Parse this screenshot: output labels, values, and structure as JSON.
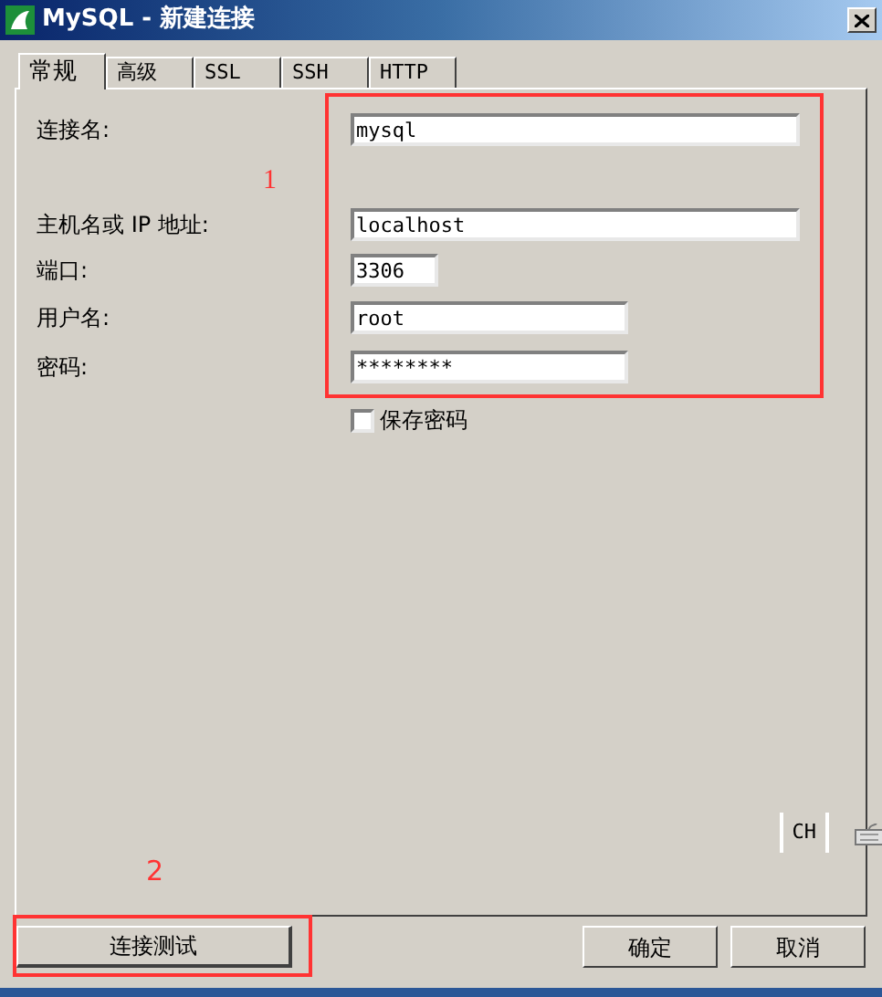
{
  "window": {
    "title": "MySQL - 新建连接"
  },
  "tabs": [
    {
      "label": "常规",
      "selected": true
    },
    {
      "label": "高级",
      "selected": false
    },
    {
      "label": "SSL",
      "selected": false
    },
    {
      "label": "SSH",
      "selected": false
    },
    {
      "label": "HTTP",
      "selected": false
    }
  ],
  "form": {
    "fields": [
      {
        "label": "连接名:",
        "value": "mysql",
        "kind": "wide"
      },
      {
        "label": "主机名或 IP 地址:",
        "value": "localhost",
        "kind": "wide"
      },
      {
        "label": "端口:",
        "value": "3306",
        "kind": "short"
      },
      {
        "label": "用户名:",
        "value": "root",
        "kind": "medium"
      },
      {
        "label": "密码:",
        "value": "********",
        "kind": "medium"
      }
    ],
    "save_password": {
      "label": "保存密码",
      "checked": false
    }
  },
  "ime": {
    "label": "CH"
  },
  "buttons": [
    {
      "label": "连接测试",
      "kind": "test"
    },
    {
      "label": "确定",
      "kind": "ok"
    },
    {
      "label": "取消",
      "kind": "cancel"
    }
  ],
  "annotations": [
    {
      "label": "1"
    },
    {
      "label": "2"
    }
  ]
}
